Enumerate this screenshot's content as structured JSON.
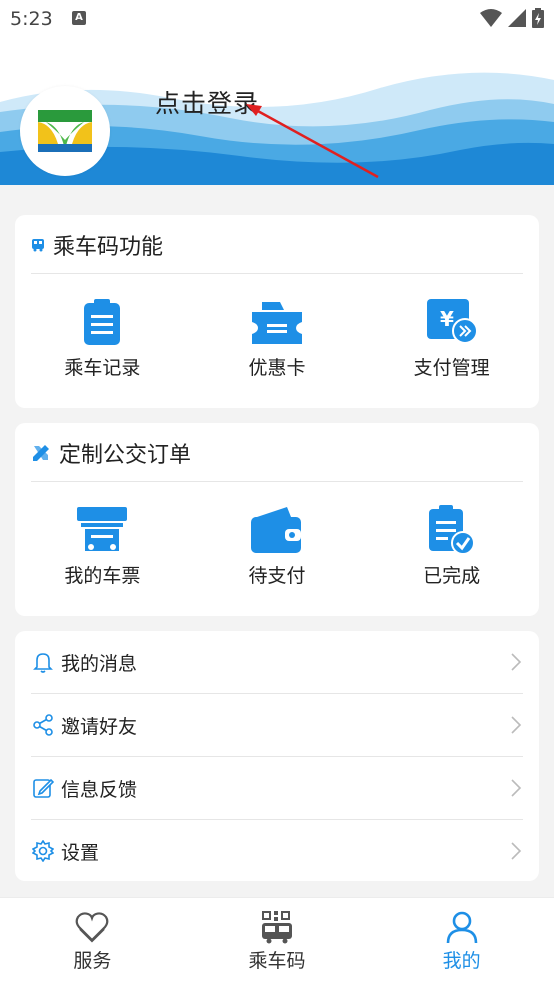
{
  "status": {
    "time": "5:23",
    "notif_icon": "A"
  },
  "header": {
    "login_text": "点击登录"
  },
  "ride_code": {
    "title": "乘车码功能",
    "items": [
      {
        "label": "乘车记录",
        "icon": "clipboard-icon"
      },
      {
        "label": "优惠卡",
        "icon": "ticket-card-icon"
      },
      {
        "label": "支付管理",
        "icon": "yuan-payment-icon"
      }
    ]
  },
  "custom_bus": {
    "title": "定制公交订单",
    "items": [
      {
        "label": "我的车票",
        "icon": "ticket-machine-icon"
      },
      {
        "label": "待支付",
        "icon": "wallet-icon"
      },
      {
        "label": "已完成",
        "icon": "completed-clipboard-icon"
      }
    ]
  },
  "menu": [
    {
      "label": "我的消息",
      "icon": "bell-icon"
    },
    {
      "label": "邀请好友",
      "icon": "share-icon"
    },
    {
      "label": "信息反馈",
      "icon": "edit-icon"
    },
    {
      "label": "设置",
      "icon": "gear-icon"
    }
  ],
  "tabbar": [
    {
      "label": "服务",
      "icon": "heart-icon"
    },
    {
      "label": "乘车码",
      "icon": "bus-qr-icon"
    },
    {
      "label": "我的",
      "icon": "user-icon",
      "active": true
    }
  ],
  "colors": {
    "accent": "#1e8fe6",
    "wave_dark": "#1e88d6",
    "wave_light": "#8fcbef"
  }
}
